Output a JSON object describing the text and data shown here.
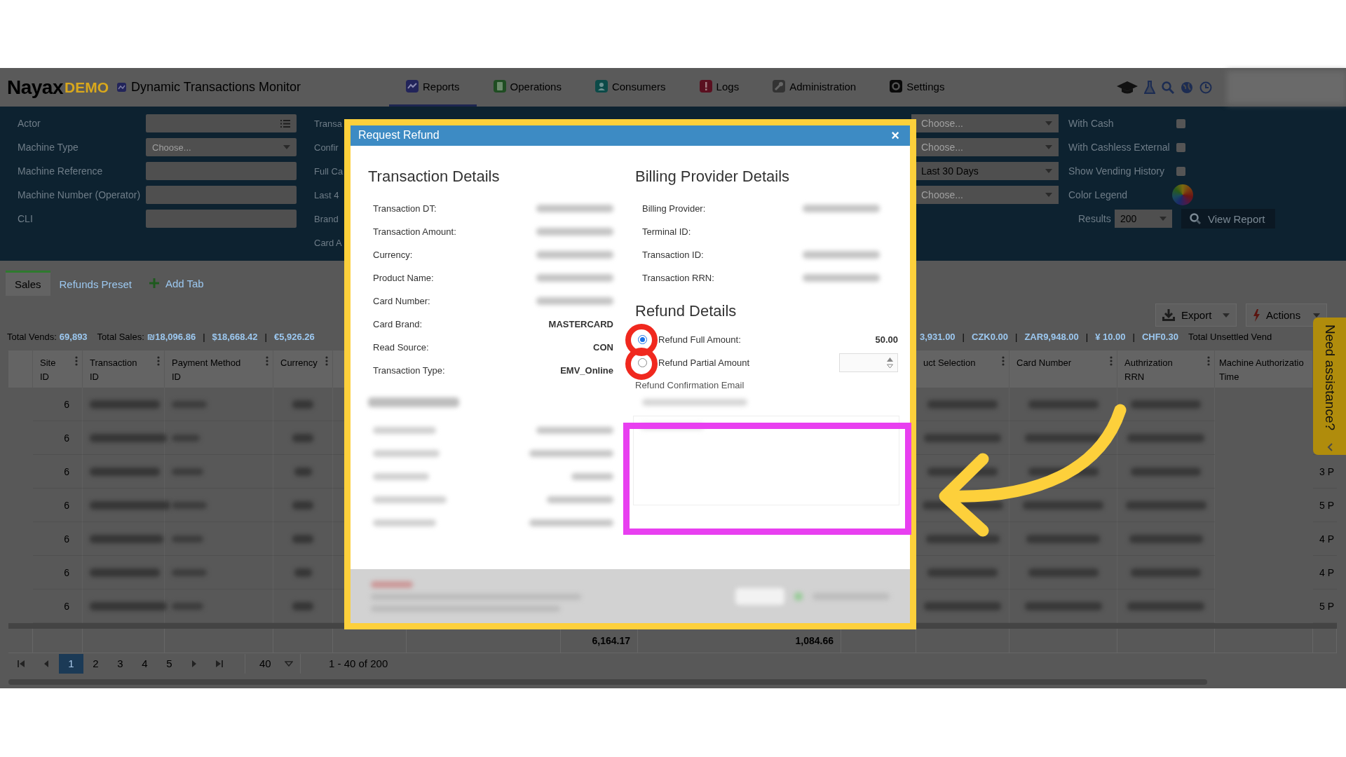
{
  "header": {
    "logo": "Nayax",
    "logo_badge": "DEMO",
    "title": "Dynamic Transactions Monitor",
    "nav": [
      {
        "label": "Reports",
        "selected": true,
        "kind": "reports"
      },
      {
        "label": "Operations",
        "selected": false,
        "kind": "operations"
      },
      {
        "label": "Consumers",
        "selected": false,
        "kind": "consumers"
      },
      {
        "label": "Logs",
        "selected": false,
        "kind": "logs"
      },
      {
        "label": "Administration",
        "selected": false,
        "kind": "administration"
      },
      {
        "label": "Settings",
        "selected": false,
        "kind": "settings"
      }
    ]
  },
  "filters": {
    "fields": [
      {
        "label": "Actor",
        "kind": "list"
      },
      {
        "label": "Machine Type",
        "kind": "select",
        "placeholder": "Choose..."
      },
      {
        "label": "Machine Reference",
        "kind": "text"
      },
      {
        "label": "Machine Number (Operator)",
        "kind": "text"
      },
      {
        "label": "CLI",
        "kind": "text"
      }
    ],
    "cut_labels": [
      "Transa",
      "Confir",
      "Full Ca",
      "Last 4",
      "Brand",
      "Card A"
    ],
    "selects": [
      {
        "placeholder": "Choose..."
      },
      {
        "placeholder": "Choose..."
      },
      {
        "value": "Last 30 Days"
      },
      {
        "placeholder": "Choose..."
      }
    ],
    "options": [
      {
        "label": "With Cash",
        "checked": false
      },
      {
        "label": "With Cashless External",
        "checked": false
      },
      {
        "label": "Show Vending History",
        "checked": false
      }
    ],
    "color_legend": "Color Legend",
    "results_label": "Results",
    "results_value": "200",
    "view_report": "View Report"
  },
  "report": {
    "tabs": [
      {
        "label": "Sales",
        "selected": true
      },
      {
        "label": "Refunds Preset",
        "selected": false
      }
    ],
    "add_tab": "Add Tab",
    "export": "Export",
    "actions": "Actions",
    "totals_left": [
      {
        "kind": "label",
        "text": "Total Vends:"
      },
      {
        "kind": "value",
        "text": "69,893"
      },
      {
        "kind": "label",
        "text": "Total Sales:"
      },
      {
        "kind": "value",
        "text": "₪18,096.86"
      },
      {
        "kind": "sep",
        "text": "|"
      },
      {
        "kind": "value",
        "text": "$18,668.42"
      },
      {
        "kind": "sep",
        "text": "|"
      },
      {
        "kind": "value",
        "text": "€5,926.26"
      }
    ],
    "totals_right": [
      {
        "kind": "value",
        "text": "3,931.00"
      },
      {
        "kind": "sep",
        "text": "|"
      },
      {
        "kind": "value",
        "text": "CZK0.00"
      },
      {
        "kind": "sep",
        "text": "|"
      },
      {
        "kind": "value",
        "text": "ZAR9,948.00"
      },
      {
        "kind": "sep",
        "text": "|"
      },
      {
        "kind": "value",
        "text": "¥ 10.00"
      },
      {
        "kind": "sep",
        "text": "|"
      },
      {
        "kind": "value",
        "text": "CHF0.30"
      },
      {
        "kind": "label",
        "text": "Total Unsettled Vend"
      }
    ]
  },
  "table": {
    "columns_left": [
      {
        "lines": [
          "Site",
          "ID"
        ]
      },
      {
        "lines": [
          "Transaction",
          "ID"
        ]
      },
      {
        "lines": [
          "Payment Method",
          "ID"
        ]
      },
      {
        "lines": [
          "Currency"
        ]
      }
    ],
    "columns_right": [
      {
        "lines": [
          "uct Selection"
        ],
        "menu": true
      },
      {
        "lines": [
          "Card Number"
        ],
        "menu": true
      },
      {
        "lines": [
          "Authrization",
          "RRN"
        ],
        "menu": true
      },
      {
        "lines": [
          "Machine Authorizatio",
          "Time"
        ],
        "menu": false
      }
    ],
    "rows": [
      {
        "site_id": "6"
      },
      {
        "site_id": "6"
      },
      {
        "site_id": "6",
        "time": "3 P"
      },
      {
        "site_id": "6",
        "time": "5 P"
      },
      {
        "site_id": "6",
        "time": "4 P"
      },
      {
        "site_id": "6",
        "time": "4 P"
      },
      {
        "site_id": "6",
        "time": "5 P"
      }
    ],
    "footer": [
      "6,164.17",
      "1,084.66"
    ]
  },
  "pagination": {
    "pages": [
      {
        "label": "1",
        "selected": true
      },
      {
        "label": "2",
        "selected": false
      },
      {
        "label": "3",
        "selected": false
      },
      {
        "label": "4",
        "selected": false
      },
      {
        "label": "5",
        "selected": false
      }
    ],
    "page_size": "40",
    "range": "1 - 40 of 200"
  },
  "assistance": {
    "label": "Need assistance?"
  },
  "modal": {
    "title": "Request Refund",
    "close": "×",
    "transaction": {
      "heading": "Transaction Details",
      "rows": [
        {
          "label": "Transaction DT:",
          "redacted": true
        },
        {
          "label": "Transaction Amount:",
          "redacted": true
        },
        {
          "label": "Currency:",
          "redacted": true
        },
        {
          "label": "Product Name:",
          "redacted": true
        },
        {
          "label": "Card Number:",
          "redacted": true
        },
        {
          "label": "Card Brand:",
          "value": "MASTERCARD"
        },
        {
          "label": "Read Source:",
          "value": "CON"
        },
        {
          "label": "Transaction Type:",
          "value": "EMV_Online"
        }
      ]
    },
    "billing": {
      "heading": "Billing Provider Details",
      "rows": [
        {
          "label": "Billing Provider:",
          "redacted": true
        },
        {
          "label": "Terminal ID:"
        },
        {
          "label": "Transaction ID:",
          "redacted": true
        },
        {
          "label": "Transaction RRN:",
          "redacted": true
        }
      ]
    },
    "refund": {
      "heading": "Refund Details",
      "options": [
        {
          "kind": "fixed",
          "label": "Refund Full Amount:",
          "selected": true,
          "amount": "50.00"
        },
        {
          "kind": "input",
          "label": "Refund Partial Amount",
          "selected": false
        }
      ],
      "email_label": "Refund Confirmation Email"
    }
  }
}
